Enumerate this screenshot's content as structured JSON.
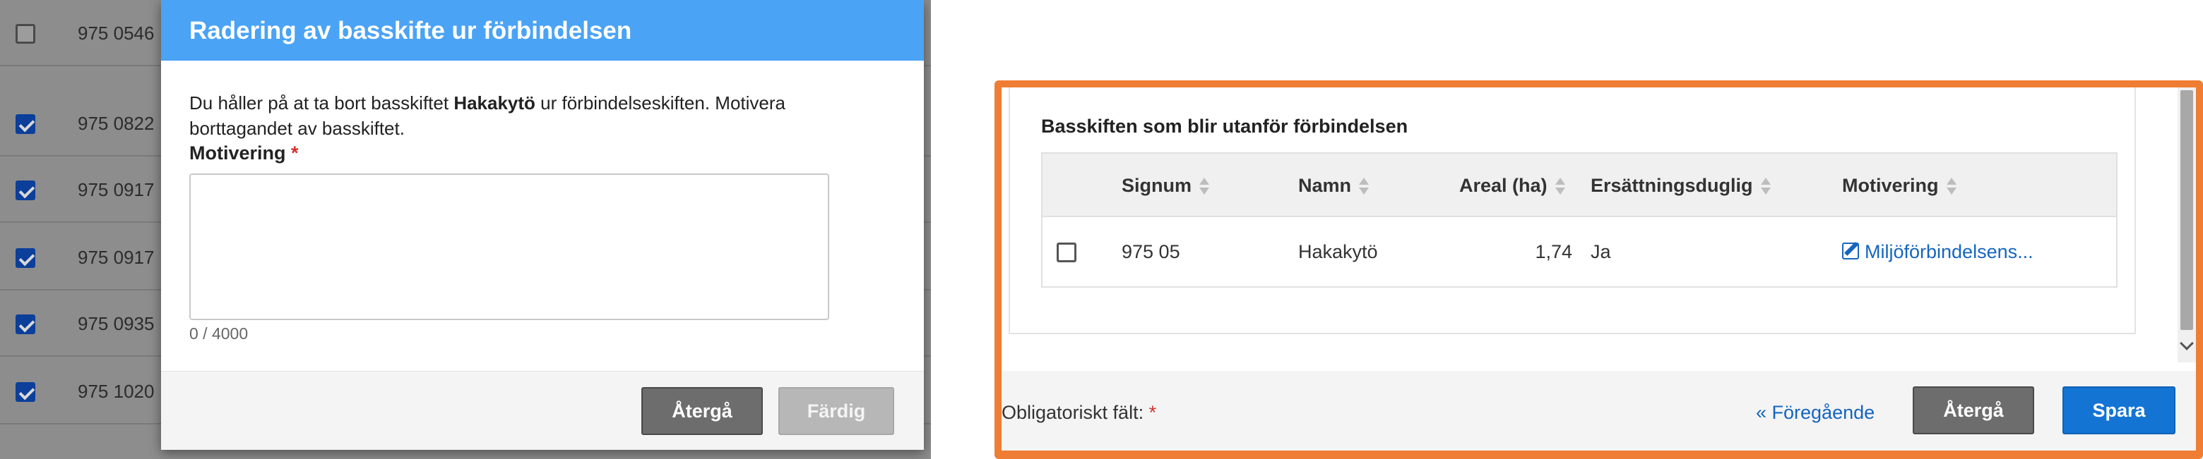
{
  "background_list": {
    "rows": [
      {
        "checked": false,
        "signum": "975 0546"
      },
      {
        "checked": true,
        "signum": "975 0822"
      },
      {
        "checked": true,
        "signum": "975 0917"
      },
      {
        "checked": true,
        "signum": "975 0917"
      },
      {
        "checked": true,
        "signum": "975 0935"
      },
      {
        "checked": true,
        "signum": "975 1020"
      }
    ]
  },
  "modal": {
    "title": "Radering av basskifte ur förbindelsen",
    "body_prefix": "Du håller på at ta bort basskiftet ",
    "body_bold": "Hakakytö",
    "body_line1_suffix": " ur förbindelseskiften. Motivera",
    "body_line2": "borttagandet av basskiftet.",
    "motivation_label": "Motivering",
    "required_marker": "*",
    "motivation_value": "",
    "char_counter": "0 / 4000",
    "back_button": "Återgå",
    "done_button": "Färdig"
  },
  "panel": {
    "section_title": "Basskiften som blir utanför förbindelsen",
    "columns": [
      "Signum",
      "Namn",
      "Areal (ha)",
      "Ersättningsduglig",
      "Motivering"
    ],
    "row": {
      "signum": "975 05",
      "name": "Hakakytö",
      "area": "1,74",
      "eligible": "Ja",
      "motivation_link": "Miljöförbindelsens..."
    },
    "required_note": "Obligatoriskt fält:",
    "required_marker": "*",
    "prev_link": "« Föregående",
    "back_button": "Återgå",
    "save_button": "Spara"
  },
  "colors": {
    "modal_header": "#4aa3f5",
    "highlight_border": "#ef7d33",
    "primary_button": "#1474d4",
    "link": "#1565c0",
    "required": "#d32f2f"
  }
}
